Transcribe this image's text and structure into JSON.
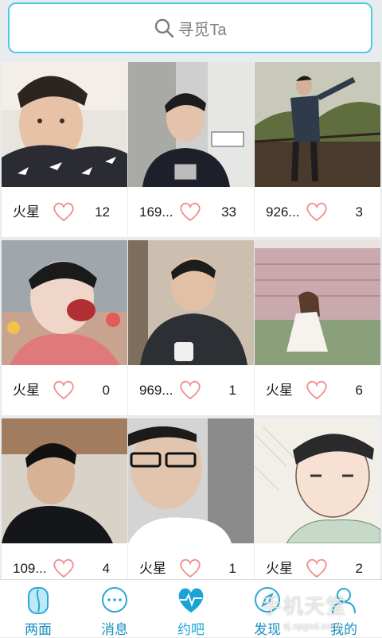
{
  "search": {
    "placeholder": "寻觅Ta"
  },
  "cards": [
    {
      "name": "火星",
      "likes": "12",
      "photo": "selfie-boy-shark-sweater"
    },
    {
      "name": "169...",
      "likes": "33",
      "photo": "mirror-selfie-boy"
    },
    {
      "name": "926...",
      "likes": "3",
      "photo": "boy-posing-outdoors"
    },
    {
      "name": "火星",
      "likes": "0",
      "photo": "boy-with-face-paint"
    },
    {
      "name": "969...",
      "likes": "1",
      "photo": "man-in-cafe"
    },
    {
      "name": "火星",
      "likes": "6",
      "photo": "girl-white-dress"
    },
    {
      "name": "109...",
      "likes": "4",
      "photo": "boy-in-black-jacket"
    },
    {
      "name": "火星",
      "likes": "1",
      "photo": "man-with-glasses"
    },
    {
      "name": "火星",
      "likes": "2",
      "photo": "sketch-filter-selfie"
    }
  ],
  "tabs": [
    {
      "label": "两面",
      "icon": "two-faces-icon"
    },
    {
      "label": "消息",
      "icon": "message-bubble-icon"
    },
    {
      "label": "约吧",
      "icon": "heartbeat-icon",
      "active": true
    },
    {
      "label": "发现",
      "icon": "discover-icon"
    },
    {
      "label": "我的",
      "icon": "user-icon"
    }
  ],
  "watermark": {
    "main": "手机天堂",
    "sub": "sj.xpgod.com"
  },
  "colors": {
    "accent": "#4fc9e9",
    "heart": "#f28b8b",
    "tab_text": "#1a8fbf"
  }
}
